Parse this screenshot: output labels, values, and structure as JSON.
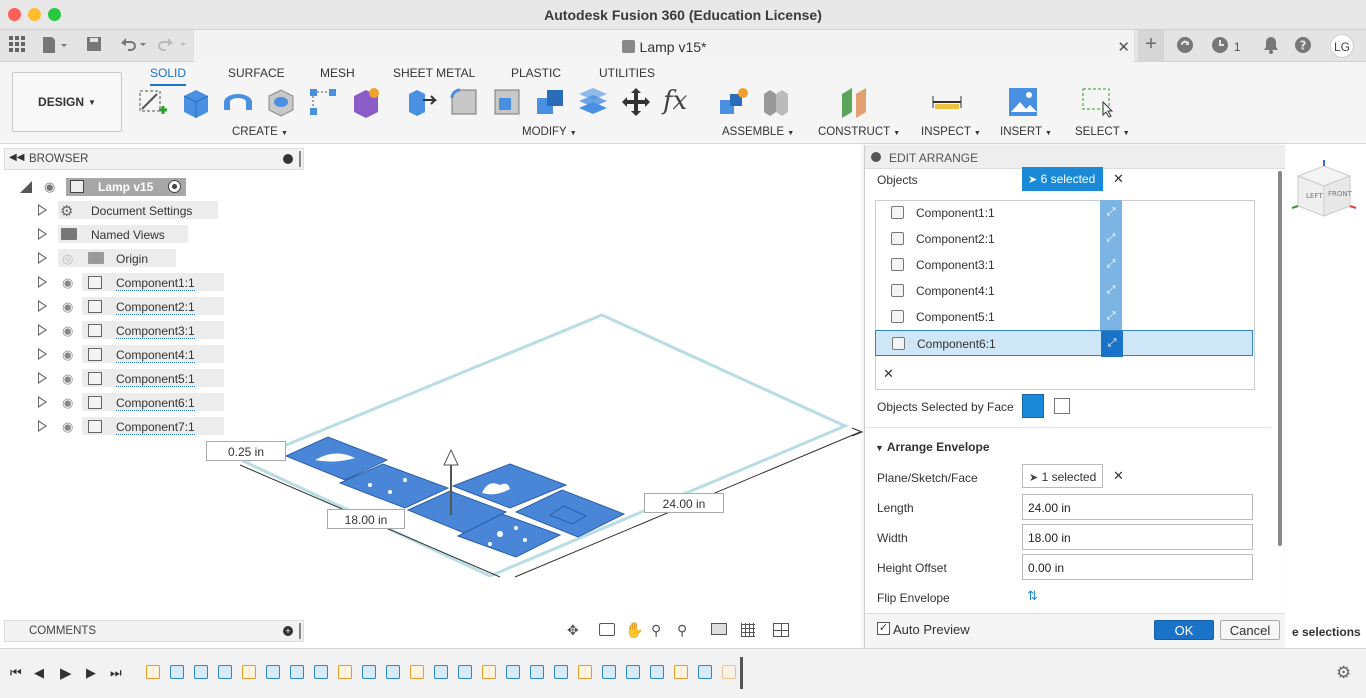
{
  "window": {
    "title": "Autodesk Fusion 360 (Education License)"
  },
  "tabbar": {
    "doc_title": "Lamp v15*",
    "jobs_count": "1",
    "user_initials": "LG"
  },
  "ribbon": {
    "workspace": "DESIGN",
    "tabs": [
      "SOLID",
      "SURFACE",
      "MESH",
      "SHEET METAL",
      "PLASTIC",
      "UTILITIES"
    ],
    "groups": [
      "CREATE",
      "MODIFY",
      "ASSEMBLE",
      "CONSTRUCT",
      "INSPECT",
      "INSERT",
      "SELECT"
    ]
  },
  "browser": {
    "title": "BROWSER",
    "root": "Lamp v15",
    "items": [
      "Document Settings",
      "Named Views",
      "Origin",
      "Component1:1",
      "Component2:1",
      "Component3:1",
      "Component4:1",
      "Component5:1",
      "Component6:1",
      "Component7:1"
    ]
  },
  "comments": {
    "title": "COMMENTS"
  },
  "viewport": {
    "dim_height": "0.25 in",
    "dim_width": "18.00 in",
    "dim_length": "24.00 in",
    "viewcube_left": "LEFT",
    "viewcube_front": "FRONT"
  },
  "panel": {
    "title": "EDIT ARRANGE",
    "objects_label": "Objects",
    "objects_selected": "6 selected",
    "objects": [
      "Component1:1",
      "Component2:1",
      "Component3:1",
      "Component4:1",
      "Component5:1",
      "Component6:1"
    ],
    "selected_object": "Component6:1",
    "by_face_label": "Objects Selected by Face",
    "envelope_section": "Arrange Envelope",
    "plane_label": "Plane/Sketch/Face",
    "plane_selected": "1 selected",
    "length_label": "Length",
    "length_value": "24.00 in",
    "width_label": "Width",
    "width_value": "18.00 in",
    "height_label": "Height Offset",
    "height_value": "0.00 in",
    "flip_label": "Flip Envelope",
    "auto_preview": "Auto Preview",
    "ok": "OK",
    "cancel": "Cancel"
  },
  "overflow_text": "e selections",
  "colors": {
    "accent": "#1a73c8",
    "part_blue": "#4a86d8",
    "envelope": "#b8dde4"
  }
}
